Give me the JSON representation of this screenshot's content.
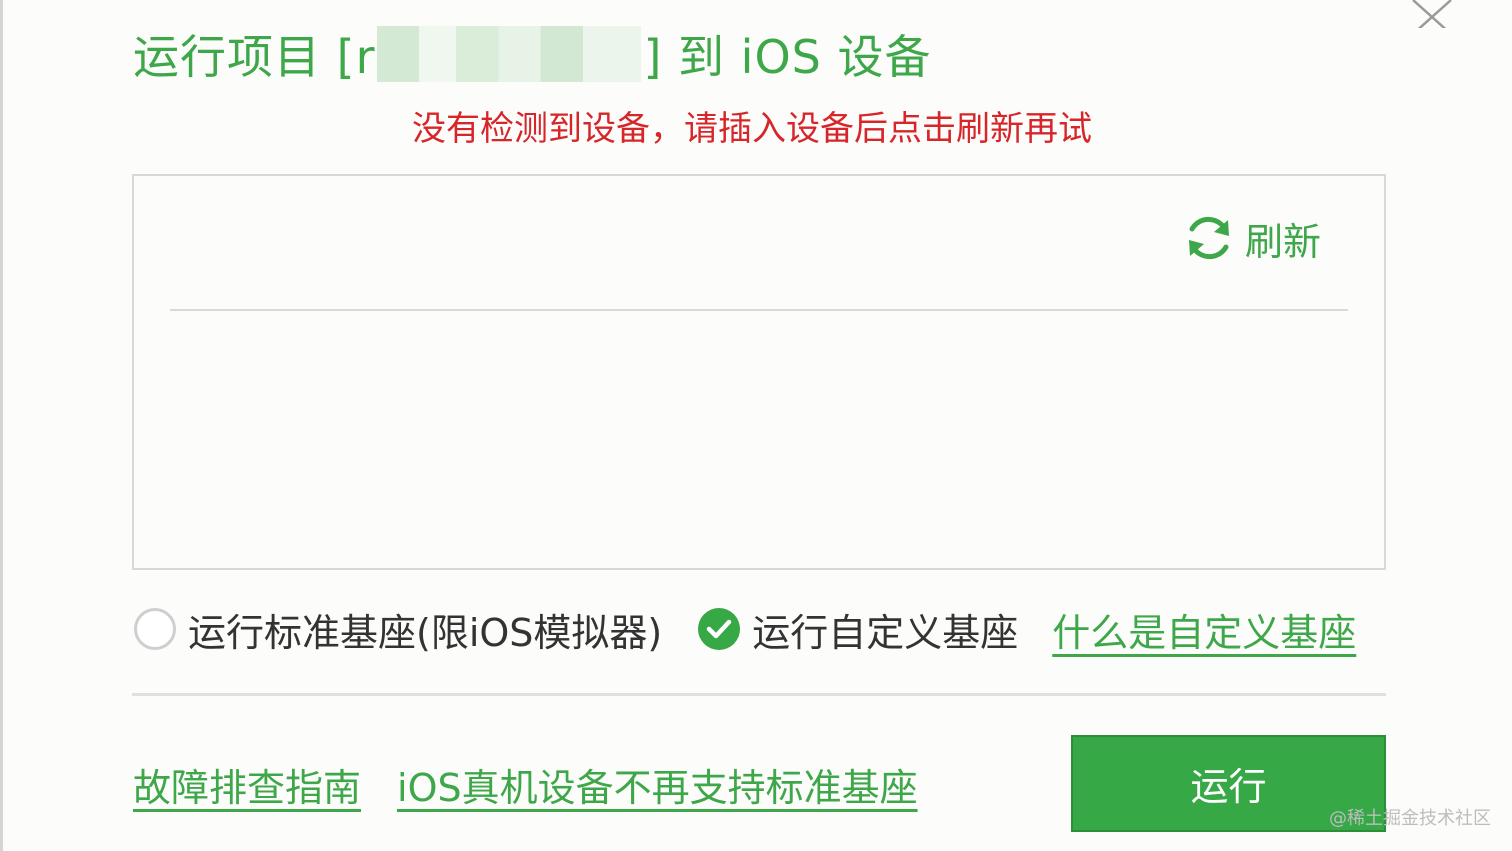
{
  "dialog": {
    "title_prefix": "运行项目 [r",
    "title_suffix": "] 到 iOS 设备",
    "warning": "没有检测到设备，请插入设备后点击刷新再试",
    "refresh_label": "刷新"
  },
  "options": {
    "standard_label": "运行标准基座(限iOS模拟器)",
    "standard_selected": false,
    "custom_label": "运行自定义基座",
    "custom_selected": true,
    "custom_help_link": "什么是自定义基座"
  },
  "footer": {
    "troubleshoot_link": "故障排查指南",
    "standard_unsupported_link": "iOS真机设备不再支持标准基座",
    "run_button": "运行"
  },
  "watermark": "@稀土掘金技术社区",
  "colors": {
    "accent": "#3ea74a",
    "warning": "#d7262a",
    "button": "#37a846"
  },
  "icons": [
    "close-icon",
    "refresh-icon",
    "radio-empty-icon",
    "check-circle-icon"
  ]
}
